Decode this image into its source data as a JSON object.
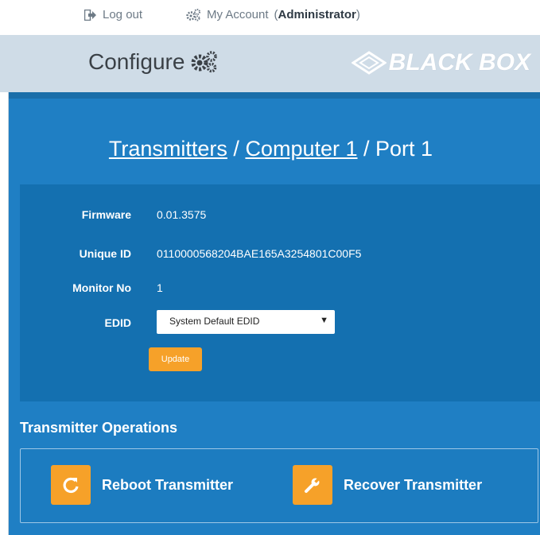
{
  "topbar": {
    "logout_label": "Log out",
    "account_label": "My Account",
    "account_role": "Administrator"
  },
  "header": {
    "title": "Configure",
    "logo_text": "BLACK BOX"
  },
  "breadcrumb": {
    "level1": "Transmitters",
    "sep1": " / ",
    "level2": "Computer 1",
    "sep2": " / ",
    "current": "Port 1"
  },
  "details": {
    "firmware_label": "Firmware",
    "firmware_value": "0.01.3575",
    "unique_id_label": "Unique ID",
    "unique_id_value": "0110000568204BAE165A3254801C00F5",
    "monitor_label": "Monitor No",
    "monitor_value": "1",
    "edid_label": "EDID",
    "edid_selected": "System Default EDID",
    "update_label": "Update"
  },
  "operations": {
    "title": "Transmitter Operations",
    "reboot_label": "Reboot Transmitter",
    "recover_label": "Recover Transmitter"
  },
  "colors": {
    "accent": "#f6a129",
    "main_blue": "#1f7fc4",
    "panel_blue": "#1470b0",
    "header_bg": "#cfdce7"
  }
}
